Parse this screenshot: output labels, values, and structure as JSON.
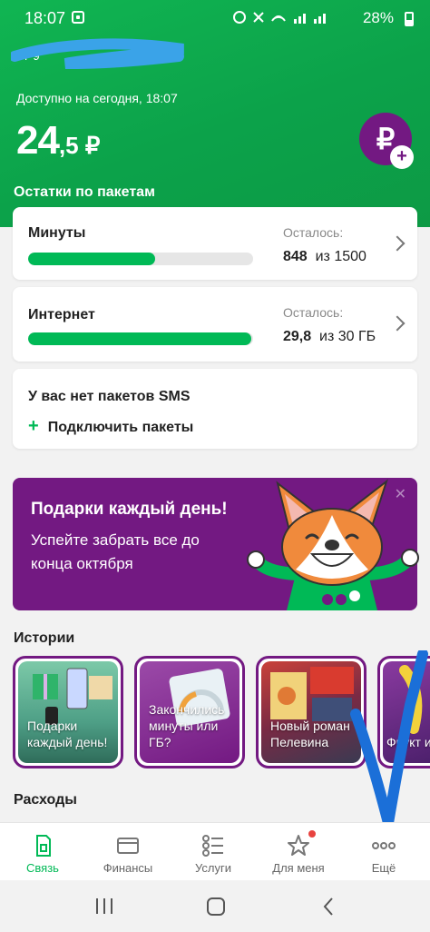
{
  "status_bar": {
    "time": "18:07",
    "battery": "28%"
  },
  "account": {
    "phone": "+7 9",
    "available_label": "Доступно на сегодня, 18:07",
    "balance_int": "24",
    "balance_dec": ",5 ₽",
    "topup_icon": "₽"
  },
  "packages": {
    "title": "Остатки по пакетам",
    "minutes": {
      "name": "Минуты",
      "left_label": "Осталось:",
      "left_value": "848",
      "left_total": "из 1500",
      "progress": 0.565
    },
    "internet": {
      "name": "Интернет",
      "left_label": "Осталось:",
      "left_value": "29,8",
      "left_total": "из 30 ГБ",
      "progress": 0.993
    },
    "sms": {
      "none_text": "У вас нет пакетов SMS",
      "connect_label": "Подключить пакеты"
    }
  },
  "promo": {
    "title": "Подарки каждый день!",
    "subtitle": "Успейте забрать все до конца октября"
  },
  "stories": {
    "title": "Истории",
    "items": [
      {
        "text": "Подарки каждый день!"
      },
      {
        "text": "Закончились минуты или ГБ?"
      },
      {
        "text": "Новый роман Пелевина"
      },
      {
        "text": "Фрукт изл"
      }
    ]
  },
  "expenses": {
    "title": "Расходы"
  },
  "bottom_nav": {
    "items": [
      {
        "label": "Связь",
        "icon": "sim-icon"
      },
      {
        "label": "Финансы",
        "icon": "card-icon"
      },
      {
        "label": "Услуги",
        "icon": "services-icon"
      },
      {
        "label": "Для меня",
        "icon": "star-icon"
      },
      {
        "label": "Ещё",
        "icon": "more-icon"
      }
    ]
  },
  "colors": {
    "brand_green": "#00b956",
    "brand_purple": "#731982"
  }
}
